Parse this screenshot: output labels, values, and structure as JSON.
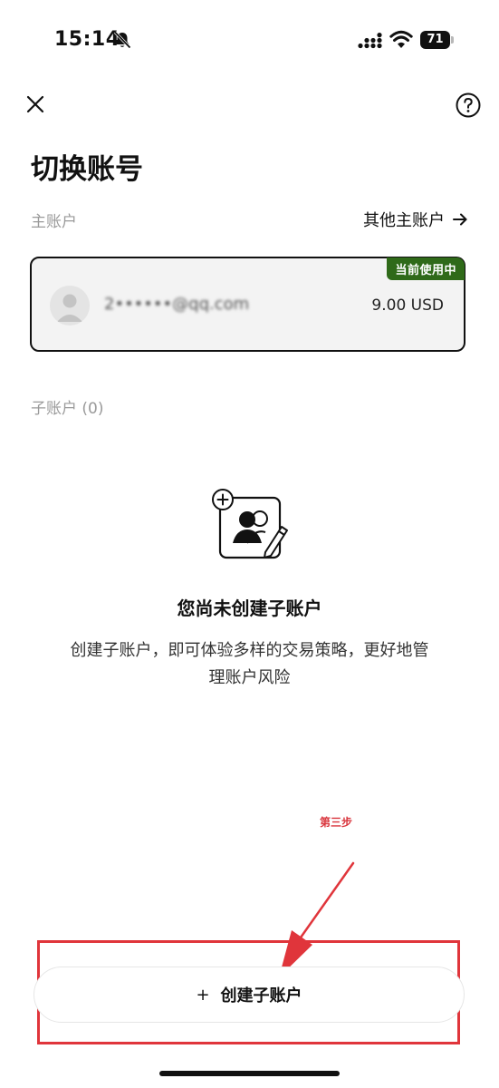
{
  "status_bar": {
    "time": "15:14",
    "battery_level": "71",
    "icons": [
      "bell-off-icon",
      "signal-icon",
      "wifi-icon",
      "battery-icon"
    ]
  },
  "header": {
    "close_icon": "close-icon",
    "help_icon": "help-icon",
    "title": "切换账号"
  },
  "main_account": {
    "section_label": "主账户",
    "other_link_label": "其他主账户",
    "card": {
      "badge": "当前使用中",
      "email": "2••••••@qq.com",
      "balance": "9.00 USD"
    }
  },
  "sub_accounts": {
    "section_label": "子账户 (0)",
    "empty_title": "您尚未创建子账户",
    "empty_description": "创建子账户，即可体验多样的交易策略，更好地管理账户风险"
  },
  "annotation": {
    "text": "第三步",
    "color": "#e0353b"
  },
  "create_button": {
    "plus": "+",
    "label": "创建子账户"
  },
  "colors": {
    "badge_green": "#2f6a19",
    "card_background": "#f3f3f3",
    "muted_text": "#9a9a9a"
  }
}
